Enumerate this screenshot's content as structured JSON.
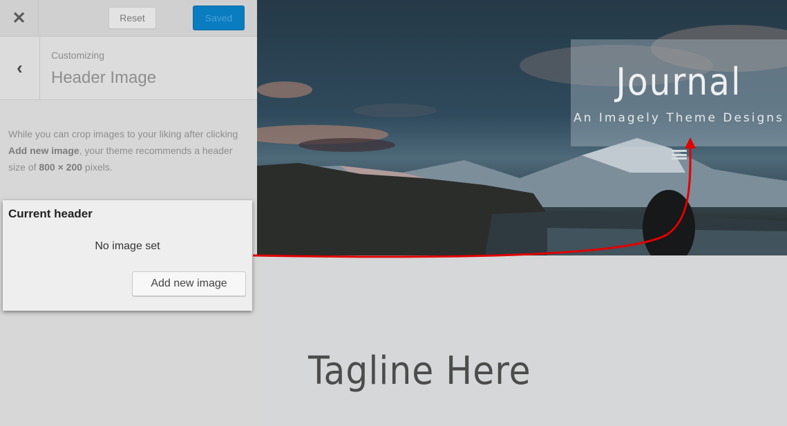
{
  "toolbar": {
    "close_icon": "close-icon",
    "reset_label": "Reset",
    "saved_label": "Saved"
  },
  "section": {
    "breadcrumb": "Customizing",
    "title": "Header Image"
  },
  "description": {
    "part1": "While you can crop images to your liking after clicking ",
    "bold1": "Add new image",
    "part2": ", your theme recommends a header size of ",
    "bold2": "800 × 200",
    "part3": " pixels."
  },
  "panel": {
    "title": "Current header",
    "status": "No image set",
    "button_label": "Add new image"
  },
  "preview": {
    "site_title": "Journal",
    "site_description": "An Imagely Theme Designs",
    "tagline": "Tagline Here"
  },
  "colors": {
    "accent": "#0a7cc0",
    "arrow": "#e00000"
  }
}
